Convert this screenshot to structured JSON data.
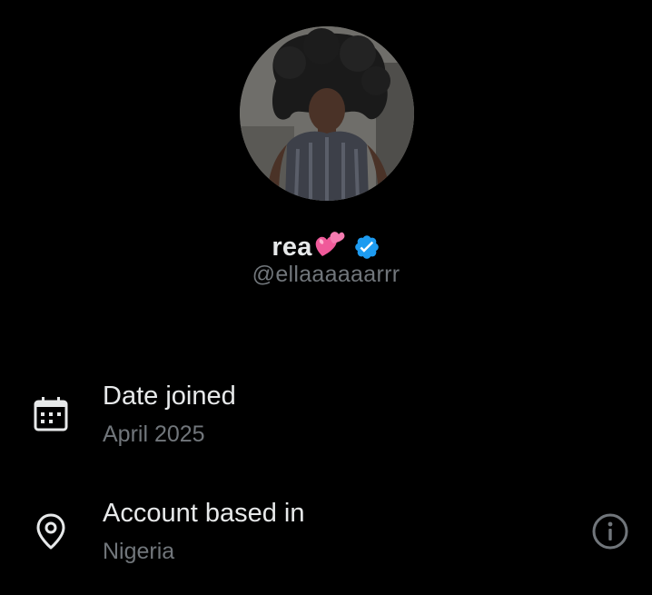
{
  "profile": {
    "display_name": "rea",
    "name_emoji": "💕",
    "handle": "@ellaaaaaarrr",
    "verified": true
  },
  "about": {
    "date_joined": {
      "title": "Date joined",
      "value": "April 2025",
      "icon": "calendar-icon"
    },
    "account_based_in": {
      "title": "Account based in",
      "value": "Nigeria",
      "icon": "location-pin-icon",
      "action_icon": "info-icon"
    }
  },
  "colors": {
    "background": "#000000",
    "primary_text": "#e7e9ea",
    "secondary_text": "#71767b",
    "verified_blue": "#1d9bf0",
    "heart_pink": "#f05a9a"
  }
}
